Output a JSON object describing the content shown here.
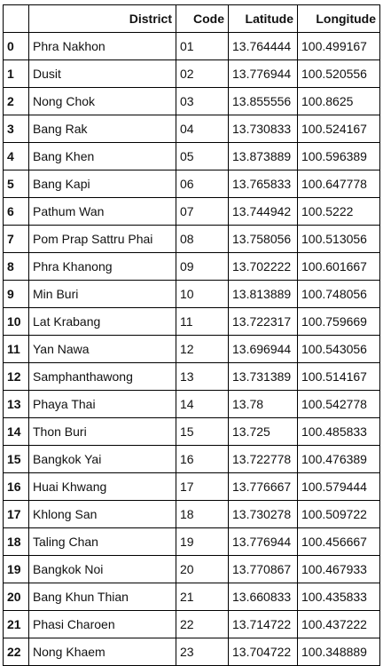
{
  "table": {
    "columns": [
      "",
      "District",
      "Code",
      "Latitude",
      "Longitude"
    ],
    "rows": [
      [
        "0",
        "Phra Nakhon",
        "01",
        "13.764444",
        "100.499167"
      ],
      [
        "1",
        "Dusit",
        "02",
        "13.776944",
        "100.520556"
      ],
      [
        "2",
        "Nong Chok",
        "03",
        "13.855556",
        "100.8625"
      ],
      [
        "3",
        "Bang Rak",
        "04",
        "13.730833",
        "100.524167"
      ],
      [
        "4",
        "Bang Khen",
        "05",
        "13.873889",
        "100.596389"
      ],
      [
        "5",
        "Bang Kapi",
        "06",
        "13.765833",
        "100.647778"
      ],
      [
        "6",
        "Pathum Wan",
        "07",
        "13.744942",
        "100.5222"
      ],
      [
        "7",
        "Pom Prap Sattru Phai",
        "08",
        "13.758056",
        "100.513056"
      ],
      [
        "8",
        "Phra Khanong",
        "09",
        "13.702222",
        "100.601667"
      ],
      [
        "9",
        "Min Buri",
        "10",
        "13.813889",
        "100.748056"
      ],
      [
        "10",
        "Lat Krabang",
        "11",
        "13.722317",
        "100.759669"
      ],
      [
        "11",
        "Yan Nawa",
        "12",
        "13.696944",
        "100.543056"
      ],
      [
        "12",
        "Samphanthawong",
        "13",
        "13.731389",
        "100.514167"
      ],
      [
        "13",
        "Phaya Thai",
        "14",
        "13.78",
        "100.542778"
      ],
      [
        "14",
        "Thon Buri",
        "15",
        "13.725",
        "100.485833"
      ],
      [
        "15",
        "Bangkok Yai",
        "16",
        "13.722778",
        "100.476389"
      ],
      [
        "16",
        "Huai Khwang",
        "17",
        "13.776667",
        "100.579444"
      ],
      [
        "17",
        "Khlong San",
        "18",
        "13.730278",
        "100.509722"
      ],
      [
        "18",
        "Taling Chan",
        "19",
        "13.776944",
        "100.456667"
      ],
      [
        "19",
        "Bangkok Noi",
        "20",
        "13.770867",
        "100.467933"
      ],
      [
        "20",
        "Bang Khun Thian",
        "21",
        "13.660833",
        "100.435833"
      ],
      [
        "21",
        "Phasi Charoen",
        "22",
        "13.714722",
        "100.437222"
      ],
      [
        "22",
        "Nong Khaem",
        "23",
        "13.704722",
        "100.348889"
      ]
    ]
  }
}
